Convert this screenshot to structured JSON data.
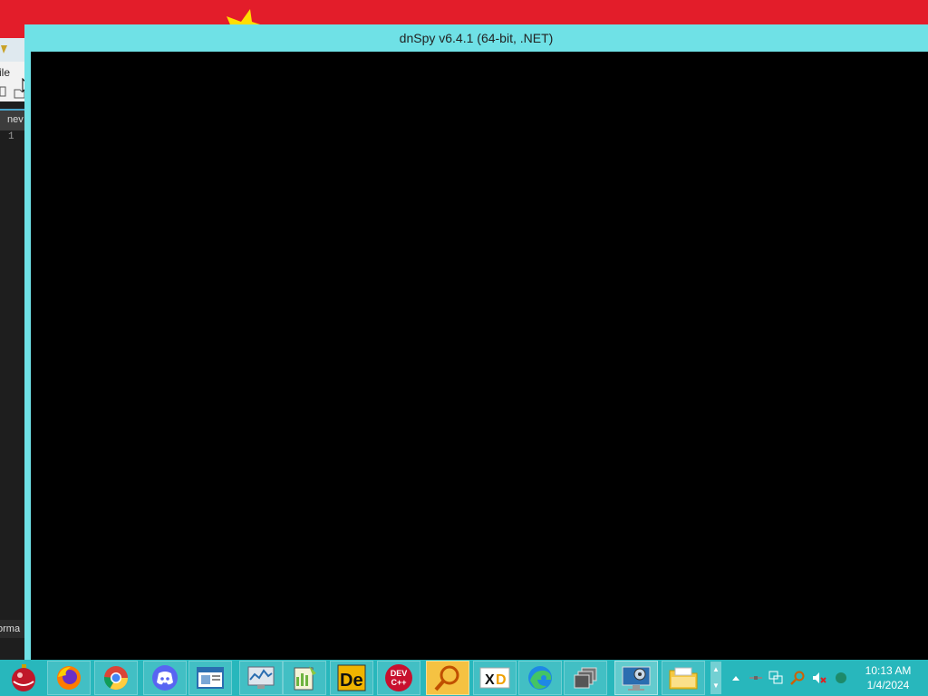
{
  "desktop": {
    "background_color": "#e31d2a"
  },
  "background_window": {
    "menu_fragment": "ile",
    "tab_fragment": "nev",
    "line_number": "1",
    "status_fragment": "orma"
  },
  "main_window": {
    "title": "dnSpy v6.4.1 (64-bit, .NET)",
    "frame_color": "#6fe1e6",
    "client_color": "#000000"
  },
  "taskbar": {
    "color": "#28b7bc",
    "start_icon": "ornament-start-icon",
    "buttons": [
      {
        "icon": "firefox-icon"
      },
      {
        "icon": "chrome-icon"
      },
      {
        "icon": "discord-icon"
      },
      {
        "icon": "window-app-icon"
      },
      {
        "icon": "performance-monitor-icon"
      },
      {
        "icon": "notepad-plus-plus-icon"
      },
      {
        "icon": "de4dot-icon"
      },
      {
        "icon": "dev-cpp-icon",
        "text": "DEV\nC++"
      },
      {
        "icon": "search-magnifier-icon"
      },
      {
        "icon": "xd-app-icon"
      },
      {
        "icon": "edge-icon"
      },
      {
        "icon": "task-view-icon"
      },
      {
        "icon": "remote-desktop-icon"
      },
      {
        "icon": "file-explorer-icon"
      }
    ],
    "tray": {
      "icons": [
        "show-hidden-icons-arrow",
        "network-cable-icon",
        "network-icon",
        "search-tray-icon",
        "volume-muted-icon",
        "status-globe-icon"
      ],
      "time": "10:13 AM",
      "date": "1/4/2024"
    }
  }
}
